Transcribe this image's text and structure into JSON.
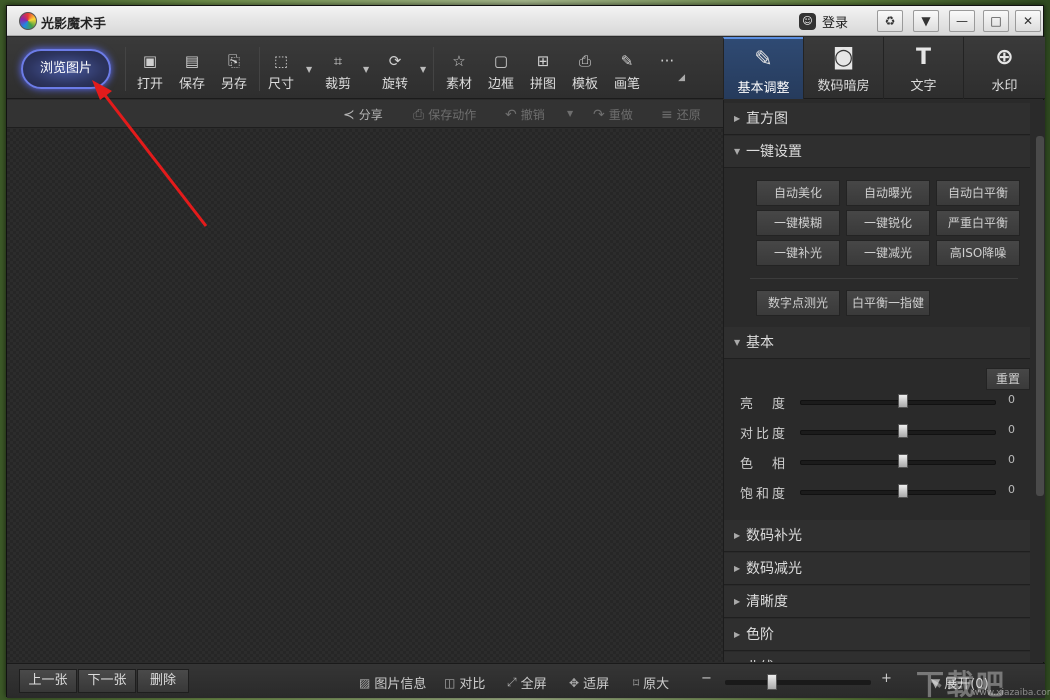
{
  "window": {
    "title": "光影魔术手",
    "login_label": "登录",
    "buttons": [
      "♻",
      "▼",
      "—",
      "□",
      "✕"
    ]
  },
  "toolbar": {
    "browse_label": "浏览图片",
    "tools": [
      {
        "label": "打开",
        "icon": "open-icon",
        "glyph": "▣"
      },
      {
        "label": "保存",
        "icon": "save-icon",
        "glyph": "▤"
      },
      {
        "label": "另存",
        "icon": "save-as-icon",
        "glyph": "⎘"
      },
      {
        "label": "尺寸",
        "icon": "resize-icon",
        "glyph": "⬚"
      },
      {
        "label": "裁剪",
        "icon": "crop-icon",
        "glyph": "⌗"
      },
      {
        "label": "旋转",
        "icon": "rotate-icon",
        "glyph": "⟳"
      },
      {
        "label": "素材",
        "icon": "material-icon",
        "glyph": "☆"
      },
      {
        "label": "边框",
        "icon": "border-icon",
        "glyph": "▢"
      },
      {
        "label": "拼图",
        "icon": "collage-icon",
        "glyph": "⊞"
      },
      {
        "label": "模板",
        "icon": "template-icon",
        "glyph": "⎙"
      },
      {
        "label": "画笔",
        "icon": "brush-icon",
        "glyph": "✎"
      },
      {
        "label": "",
        "icon": "more-icon",
        "glyph": "···"
      }
    ]
  },
  "right_tabs": [
    {
      "label": "基本调整",
      "icon": "basic-adjust-icon",
      "glyph": "✎",
      "active": true
    },
    {
      "label": "数码暗房",
      "icon": "darkroom-icon",
      "glyph": "◙",
      "active": false
    },
    {
      "label": "文字",
      "icon": "text-icon",
      "glyph": "T",
      "active": false
    },
    {
      "label": "水印",
      "icon": "watermark-icon",
      "glyph": "⊕",
      "active": false
    }
  ],
  "actions": [
    {
      "label": "分享",
      "icon": "share-icon",
      "glyph": "≺",
      "enabled": true
    },
    {
      "label": "保存动作",
      "icon": "save-action-icon",
      "glyph": "⎙",
      "enabled": false
    },
    {
      "label": "撤销",
      "icon": "undo-icon",
      "glyph": "↶",
      "enabled": false
    },
    {
      "label": "重做",
      "icon": "redo-icon",
      "glyph": "↷",
      "enabled": false
    },
    {
      "label": "还原",
      "icon": "restore-icon",
      "glyph": "≡",
      "enabled": false
    }
  ],
  "panel": {
    "sections": {
      "histogram": "直方图",
      "oneclick": "一键设置",
      "basic": "基本",
      "fill_light": "数码补光",
      "reduce_light": "数码减光",
      "sharpness": "清晰度",
      "levels": "色阶",
      "curves": "曲线"
    },
    "oneclick_buttons": [
      [
        "自动美化",
        "自动曝光",
        "自动白平衡"
      ],
      [
        "一键模糊",
        "一键锐化",
        "严重白平衡"
      ],
      [
        "一键补光",
        "一键减光",
        "高ISO降噪"
      ]
    ],
    "extra_buttons": [
      "数字点测光",
      "白平衡一指健"
    ],
    "reset_label": "重置",
    "sliders": [
      {
        "label": "亮　度",
        "value": "0"
      },
      {
        "label": "对比度",
        "value": "0"
      },
      {
        "label": "色　相",
        "value": "0"
      },
      {
        "label": "饱和度",
        "value": "0"
      }
    ]
  },
  "statusbar": {
    "prev": "上一张",
    "next": "下一张",
    "delete": "删除",
    "items": [
      {
        "label": "图片信息",
        "icon": "image-info-icon",
        "glyph": "▨"
      },
      {
        "label": "对比",
        "icon": "compare-icon",
        "glyph": "◫"
      },
      {
        "label": "全屏",
        "icon": "fullscreen-icon",
        "glyph": "⤢"
      },
      {
        "label": "适屏",
        "icon": "fit-screen-icon",
        "glyph": "✥"
      },
      {
        "label": "原大",
        "icon": "original-size-icon",
        "glyph": "⌑"
      }
    ],
    "zoom_minus": "−",
    "zoom_plus": "+",
    "expand": "展开(0)"
  },
  "watermark": {
    "text": "下载吧",
    "url": "www.xiazaiba.com"
  },
  "colors": {
    "accent": "#5c8fe0",
    "browse_glow": "#6c7ce8",
    "arrow": "#e31b1b"
  }
}
